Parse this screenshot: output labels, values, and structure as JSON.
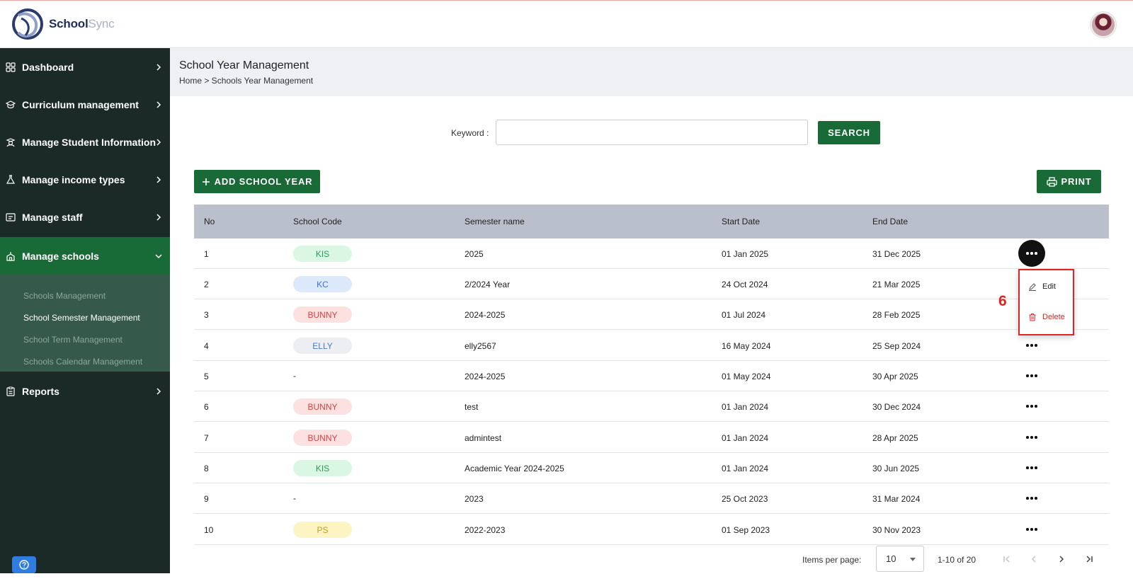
{
  "app": {
    "brand_primary": "School",
    "brand_secondary": "Sync"
  },
  "colors": {
    "sidebar_bg": "#1b2a27",
    "accent_green": "#186b36",
    "header_row": "#b9c0cb",
    "danger": "#e32222"
  },
  "sidebar": {
    "items": [
      {
        "label": "Dashboard",
        "icon": "grid-icon"
      },
      {
        "label": "Curriculum management",
        "icon": "graduation-cap-icon"
      },
      {
        "label": "Manage Student Information",
        "icon": "student-icon"
      },
      {
        "label": "Manage income types",
        "icon": "flask-icon"
      },
      {
        "label": "Manage staff",
        "icon": "id-card-icon"
      },
      {
        "label": "Manage schools",
        "icon": "school-icon"
      },
      {
        "label": "Reports",
        "icon": "clipboard-icon"
      }
    ],
    "subitems": [
      "Schools Management",
      "School Semester Management",
      "School Term Management",
      "Schools Calendar Management"
    ]
  },
  "page": {
    "title": "School Year Management",
    "breadcrumb": "Home > Schools Year Management"
  },
  "search": {
    "label": "Keyword :",
    "value": "",
    "button": "SEARCH"
  },
  "toolbar": {
    "add_label": "ADD SCHOOL YEAR",
    "print_label": "PRINT"
  },
  "table": {
    "columns": [
      "No",
      "School Code",
      "Semester name",
      "Start Date",
      "End Date"
    ],
    "rows": [
      {
        "no": "1",
        "code": "KIS",
        "name": "2025",
        "start": "01 Jan 2025",
        "end": "31 Dec 2025"
      },
      {
        "no": "2",
        "code": "KC",
        "name": "2/2024 Year",
        "start": "24 Oct 2024",
        "end": "21 Mar 2025"
      },
      {
        "no": "3",
        "code": "BUNNY",
        "name": "2024-2025",
        "start": "01 Jul 2024",
        "end": "28 Feb 2025"
      },
      {
        "no": "4",
        "code": "ELLY",
        "name": "elly2567",
        "start": "16 May 2024",
        "end": "25 Sep 2024"
      },
      {
        "no": "5",
        "code": "-",
        "name": "2024-2025",
        "start": "01 May 2024",
        "end": "30 Apr 2025"
      },
      {
        "no": "6",
        "code": "BUNNY",
        "name": "test",
        "start": "01 Jan 2024",
        "end": "30 Dec 2024"
      },
      {
        "no": "7",
        "code": "BUNNY",
        "name": "admintest",
        "start": "01 Jan 2024",
        "end": "28 Apr 2025"
      },
      {
        "no": "8",
        "code": "KIS",
        "name": "Academic Year 2024-2025",
        "start": "01 Jan 2024",
        "end": "30 Jun 2025"
      },
      {
        "no": "9",
        "code": "-",
        "name": "2023",
        "start": "25 Oct 2023",
        "end": "31 Mar 2024"
      },
      {
        "no": "10",
        "code": "PS",
        "name": "2022-2023",
        "start": "01 Sep 2023",
        "end": "30 Nov 2023"
      }
    ]
  },
  "row_menu": {
    "edit": "Edit",
    "delete": "Delete",
    "step_number": "6"
  },
  "pagination": {
    "items_label": "Items per page:",
    "page_size": "10",
    "range": "1-10 of 20"
  }
}
